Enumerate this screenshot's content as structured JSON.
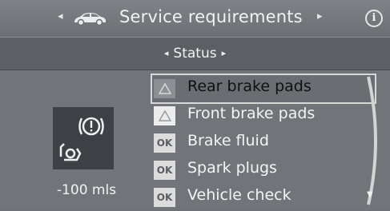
{
  "header": {
    "left_arrow": "◂",
    "right_arrow": "▸",
    "title": "Service requirements",
    "car_icon": "car-icon",
    "info_icon_text": "i"
  },
  "subheader": {
    "left_arrow": "◂",
    "right_arrow": "▸",
    "title": "Status"
  },
  "brake_panel": {
    "icon": "brake-pad-warning-icon",
    "distance": "-100 mls"
  },
  "list": {
    "items": [
      {
        "badge": "warn",
        "label": "Rear brake pads",
        "selected": true
      },
      {
        "badge": "warn",
        "label": "Front brake pads",
        "selected": false
      },
      {
        "badge": "OK",
        "label": "Brake fluid",
        "selected": false
      },
      {
        "badge": "OK",
        "label": "Spark plugs",
        "selected": false
      },
      {
        "badge": "OK",
        "label": "Vehicle check",
        "selected": false
      }
    ]
  },
  "scroll": {
    "down_arrow": "▼"
  },
  "colors": {
    "background": "#717478",
    "header": "#7f8286",
    "subheader": "#5c5f63",
    "icon_box": "#3d4044",
    "text": "#f2f2f2"
  }
}
